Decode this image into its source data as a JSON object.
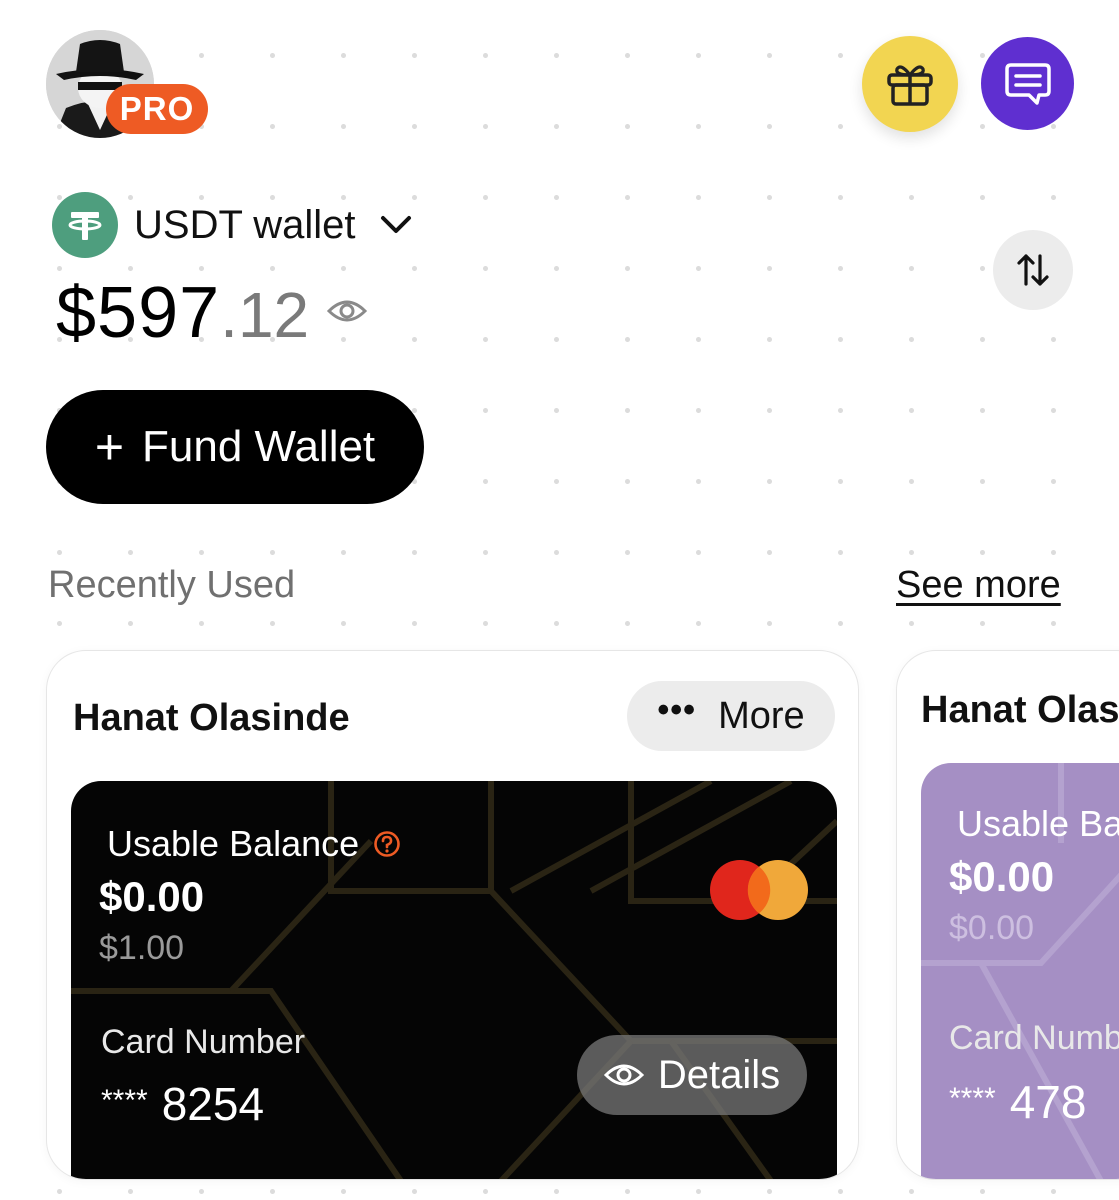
{
  "profile": {
    "badge": "PRO",
    "avatar_icon": "incognito-avatar-icon"
  },
  "header": {
    "gift_icon": "gift-icon",
    "chat_icon": "chat-icon",
    "colors": {
      "gift": "#f2d551",
      "chat": "#5f2fd0",
      "badge": "#ee5b24"
    }
  },
  "wallet": {
    "name": "USDT wallet",
    "icon": "tether-icon",
    "balance_main": "$597",
    "balance_cents": ".12",
    "fund_plus": "+",
    "fund_label": "Fund Wallet"
  },
  "recent": {
    "title": "Recently Used",
    "see_more": "See more"
  },
  "cards": [
    {
      "holder": "Hanat Olasinde",
      "more_dots": "•••",
      "more_label": "More",
      "usable_label": "Usable Balance",
      "amount": "$0.00",
      "limit": "$1.00",
      "card_number_label": "Card Number",
      "card_stars": "****",
      "card_last4": "8254",
      "details_label": "Details",
      "network": "mastercard",
      "color": "#050505"
    },
    {
      "holder": "Hanat Olas",
      "usable_label": "Usable Ba",
      "amount": "$0.00",
      "limit": "$0.00",
      "card_number_label": "Card Numb",
      "card_stars": "****",
      "card_last4": "478",
      "color": "#a58fc4"
    }
  ]
}
